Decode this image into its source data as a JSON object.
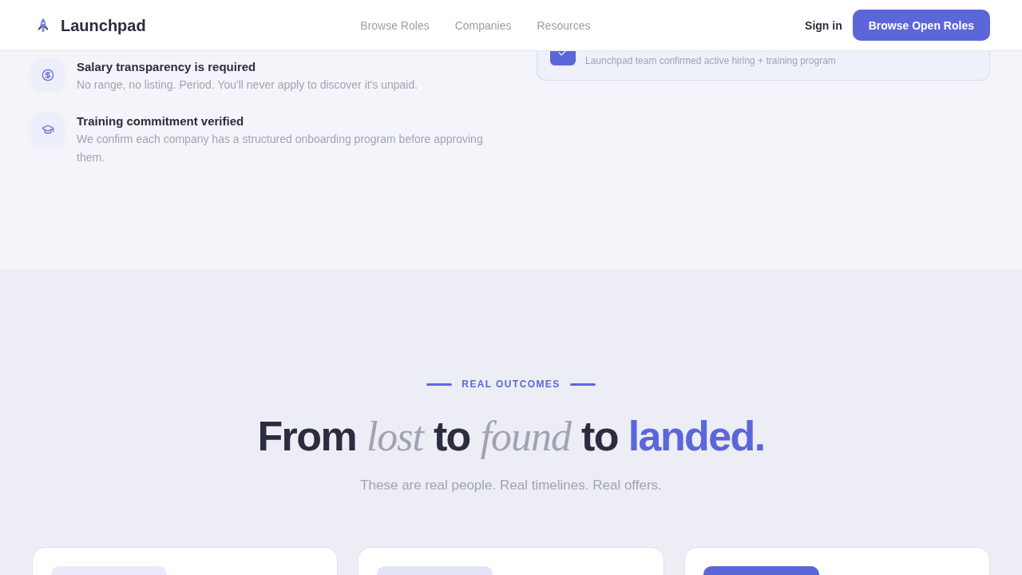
{
  "header": {
    "brand": "Launchpad",
    "nav": [
      "Browse Roles",
      "Companies",
      "Resources"
    ],
    "sign_in": "Sign in",
    "cta": "Browse Open Roles"
  },
  "features": [
    {
      "kind": "salary",
      "title": "Salary transparency is required",
      "description": "No range, no listing. Period. You'll never apply to discover it's unpaid."
    },
    {
      "kind": "training",
      "title": "Training commitment verified",
      "description": "We confirm each company has a structured onboarding program before approving them."
    }
  ],
  "verified_card": {
    "description": "Launchpad team confirmed active hiring + training program"
  },
  "outcomes": {
    "eyebrow": "REAL OUTCOMES",
    "heading": [
      {
        "text": "From",
        "kind": "plain"
      },
      {
        "text": "lost",
        "kind": "italic"
      },
      {
        "text": "to",
        "kind": "plain"
      },
      {
        "text": "found",
        "kind": "italic"
      },
      {
        "text": "to",
        "kind": "plain"
      },
      {
        "text": "landed.",
        "kind": "accent"
      }
    ],
    "subtitle": "These are real people. Real timelines. Real offers.",
    "cards": [
      {
        "color": "#ebeafb"
      },
      {
        "color": "#e3e3f7"
      },
      {
        "color": "#5b67d8"
      }
    ]
  }
}
